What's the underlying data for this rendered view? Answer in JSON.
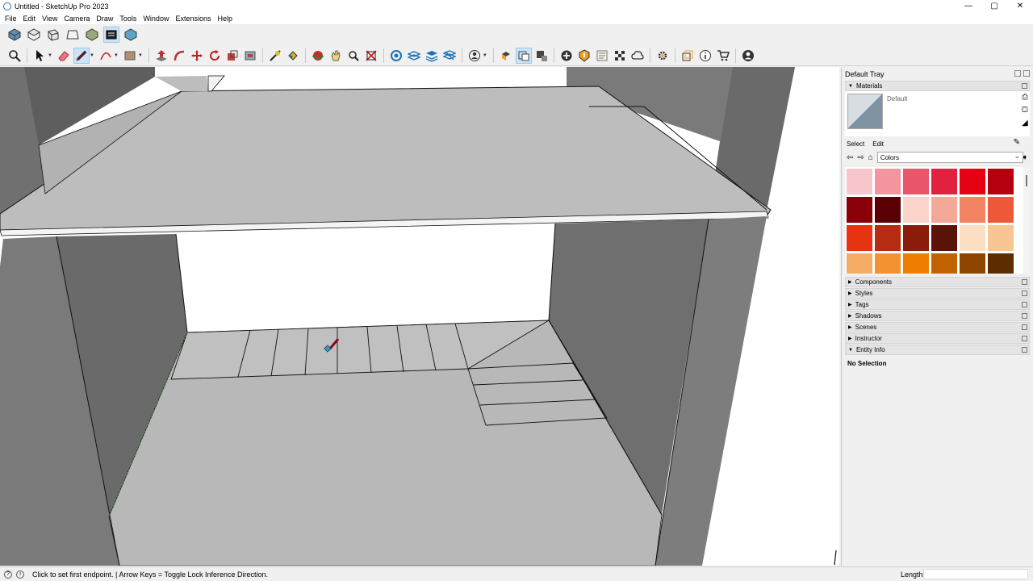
{
  "window": {
    "title": "Untitled - SketchUp Pro 2023",
    "minimize": "—",
    "maximize": "▢",
    "close": "✕"
  },
  "menu": [
    "File",
    "Edit",
    "View",
    "Camera",
    "Draw",
    "Tools",
    "Window",
    "Extensions",
    "Help"
  ],
  "toolbar": {
    "views_row": [
      "iso-view-icon",
      "top-view-icon",
      "front-view-icon",
      "right-view-icon",
      "back-view-icon",
      "left-view-icon",
      "bottom-view-icon"
    ],
    "tools_row": [
      "zoom-icon",
      "select-icon",
      "eraser-icon",
      "pencil-line-icon",
      "arc-icon",
      "rectangle-icon",
      "push-pull-icon",
      "follow-me-icon",
      "move-icon",
      "rotate-icon",
      "scale-icon",
      "offset-icon",
      "tape-measure-icon",
      "paint-bucket-icon",
      "orbit-icon",
      "pan-icon",
      "zoom-window-icon",
      "zoom-extents-icon",
      "section-plane-icon",
      "layer-icon",
      "layer-stack-icon",
      "warehouse-icon",
      "profile-icon",
      "solid-tools-icon",
      "components-icon",
      "extension-warehouse-icon",
      "add-location-icon",
      "outliner-icon",
      "3d-text-icon",
      "checker-icon",
      "cloud-icon",
      "settings-icon",
      "scenes-icon",
      "info-icon",
      "cart-icon",
      "account-icon"
    ],
    "active_tool": "pencil-line-icon"
  },
  "tray": {
    "title": "Default Tray",
    "materials": {
      "title": "Materials",
      "name": "Default",
      "select_tab": "Select",
      "edit_tab": "Edit",
      "library": "Colors",
      "swatches": [
        "#f8c5cc",
        "#f4949f",
        "#e9556a",
        "#e0223f",
        "#e50012",
        "#b5000e",
        "#8a0008",
        "#5a0004",
        "#fbd4cc",
        "#f4a898",
        "#f28463",
        "#ee5a39",
        "#e63312",
        "#b62c12",
        "#8a1c0b",
        "#5b1309",
        "#fde0c4",
        "#f9c693",
        "#f5ad65",
        "#f39233",
        "#ef7d00",
        "#c06200",
        "#8e4500",
        "#5b2d00"
      ]
    },
    "panels": [
      "Components",
      "Styles",
      "Tags",
      "Shadows",
      "Scenes",
      "Instructor"
    ],
    "entity_info": {
      "title": "Entity Info",
      "body": "No Selection"
    }
  },
  "status": {
    "message": "Click to set first endpoint. | Arrow Keys = Toggle Lock Inference Direction.",
    "measurement_label": "Length",
    "measurement_value": ""
  }
}
